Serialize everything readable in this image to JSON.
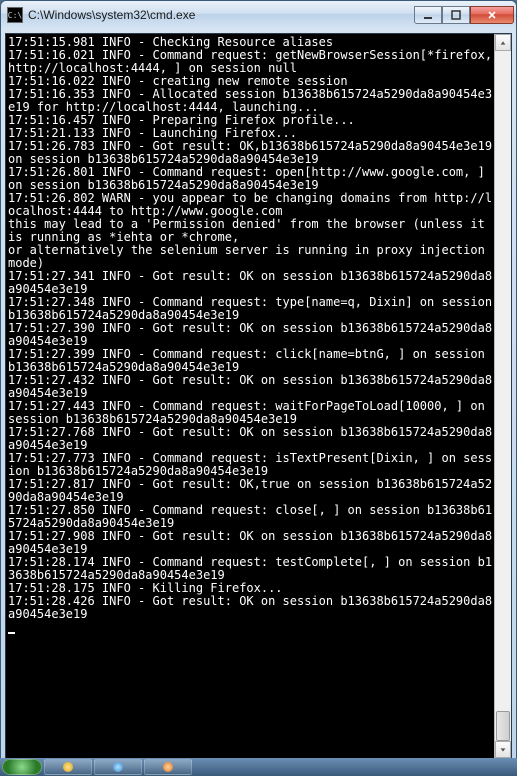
{
  "window": {
    "title": "C:\\Windows\\system32\\cmd.exe",
    "icon_glyph": "C:\\"
  },
  "buttons": {
    "minimize_tooltip": "Minimize",
    "maximize_tooltip": "Maximize",
    "close_tooltip": "Close"
  },
  "console_lines": [
    "17:51:15.981 INFO - Checking Resource aliases",
    "17:51:16.021 INFO - Command request: getNewBrowserSession[*firefox, http://localhost:4444, ] on session null",
    "17:51:16.022 INFO - creating new remote session",
    "17:51:16.353 INFO - Allocated session b13638b615724a5290da8a90454e3e19 for http://localhost:4444, launching...",
    "17:51:16.457 INFO - Preparing Firefox profile...",
    "17:51:21.133 INFO - Launching Firefox...",
    "17:51:26.783 INFO - Got result: OK,b13638b615724a5290da8a90454e3e19 on session b13638b615724a5290da8a90454e3e19",
    "17:51:26.801 INFO - Command request: open[http://www.google.com, ] on session b13638b615724a5290da8a90454e3e19",
    "17:51:26.802 WARN - you appear to be changing domains from http://localhost:4444 to http://www.google.com",
    "this may lead to a 'Permission denied' from the browser (unless it is running as *iehta or *chrome,",
    "or alternatively the selenium server is running in proxy injection mode)",
    "17:51:27.341 INFO - Got result: OK on session b13638b615724a5290da8a90454e3e19",
    "17:51:27.348 INFO - Command request: type[name=q, Dixin] on session b13638b615724a5290da8a90454e3e19",
    "17:51:27.390 INFO - Got result: OK on session b13638b615724a5290da8a90454e3e19",
    "17:51:27.399 INFO - Command request: click[name=btnG, ] on session b13638b615724a5290da8a90454e3e19",
    "17:51:27.432 INFO - Got result: OK on session b13638b615724a5290da8a90454e3e19",
    "17:51:27.443 INFO - Command request: waitForPageToLoad[10000, ] on session b13638b615724a5290da8a90454e3e19",
    "17:51:27.768 INFO - Got result: OK on session b13638b615724a5290da8a90454e3e19",
    "17:51:27.773 INFO - Command request: isTextPresent[Dixin, ] on session b13638b615724a5290da8a90454e3e19",
    "17:51:27.817 INFO - Got result: OK,true on session b13638b615724a5290da8a90454e3e19",
    "17:51:27.850 INFO - Command request: close[, ] on session b13638b615724a5290da8a90454e3e19",
    "17:51:27.908 INFO - Got result: OK on session b13638b615724a5290da8a90454e3e19",
    "17:51:28.174 INFO - Command request: testComplete[, ] on session b13638b615724a5290da8a90454e3e19",
    "17:51:28.175 INFO - Killing Firefox...",
    "17:51:28.426 INFO - Got result: OK on session b13638b615724a5290da8a90454e3e19"
  ]
}
